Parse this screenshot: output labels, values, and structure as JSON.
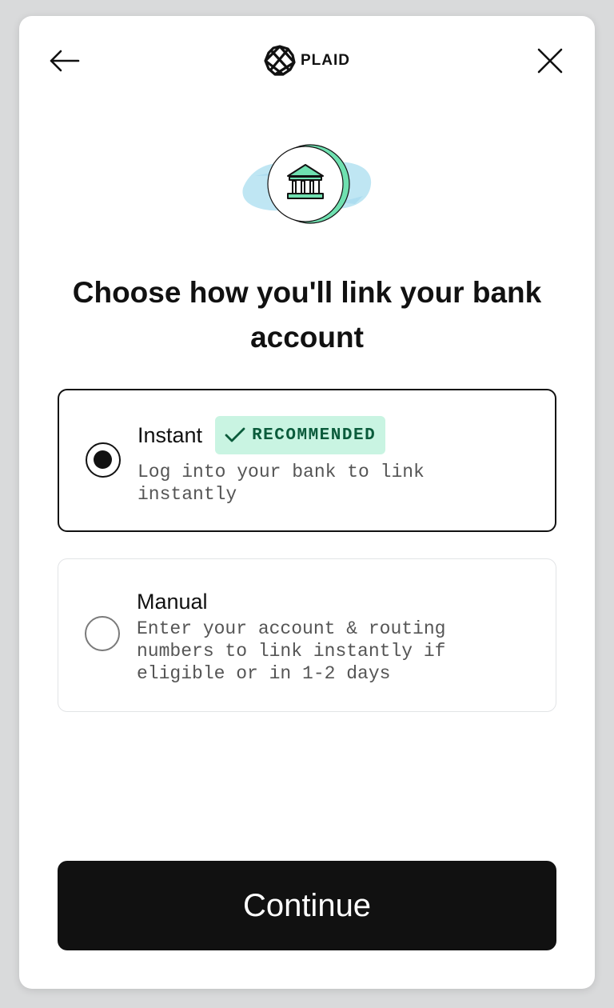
{
  "header": {
    "back_icon": "arrow-left-icon",
    "brand_logo_icon": "plaid-logo-icon",
    "brand_name": "PLAID",
    "close_icon": "close-icon"
  },
  "hero": {
    "icon": "bank-icon"
  },
  "title": "Choose how you'll link your bank account",
  "options": [
    {
      "label": "Instant",
      "badge": "RECOMMENDED",
      "badge_icon": "checkmark-icon",
      "description": "Log into your bank to link\ninstantly",
      "selected": true
    },
    {
      "label": "Manual",
      "description": "Enter your account & routing\nnumbers to link instantly if\neligible or in 1-2 days",
      "selected": false
    }
  ],
  "continue_label": "Continue",
  "colors": {
    "accent_green": "#6fe0b0",
    "badge_bg": "#c9f4e2",
    "badge_text": "#0a5b3b",
    "button_bg": "#111111"
  }
}
